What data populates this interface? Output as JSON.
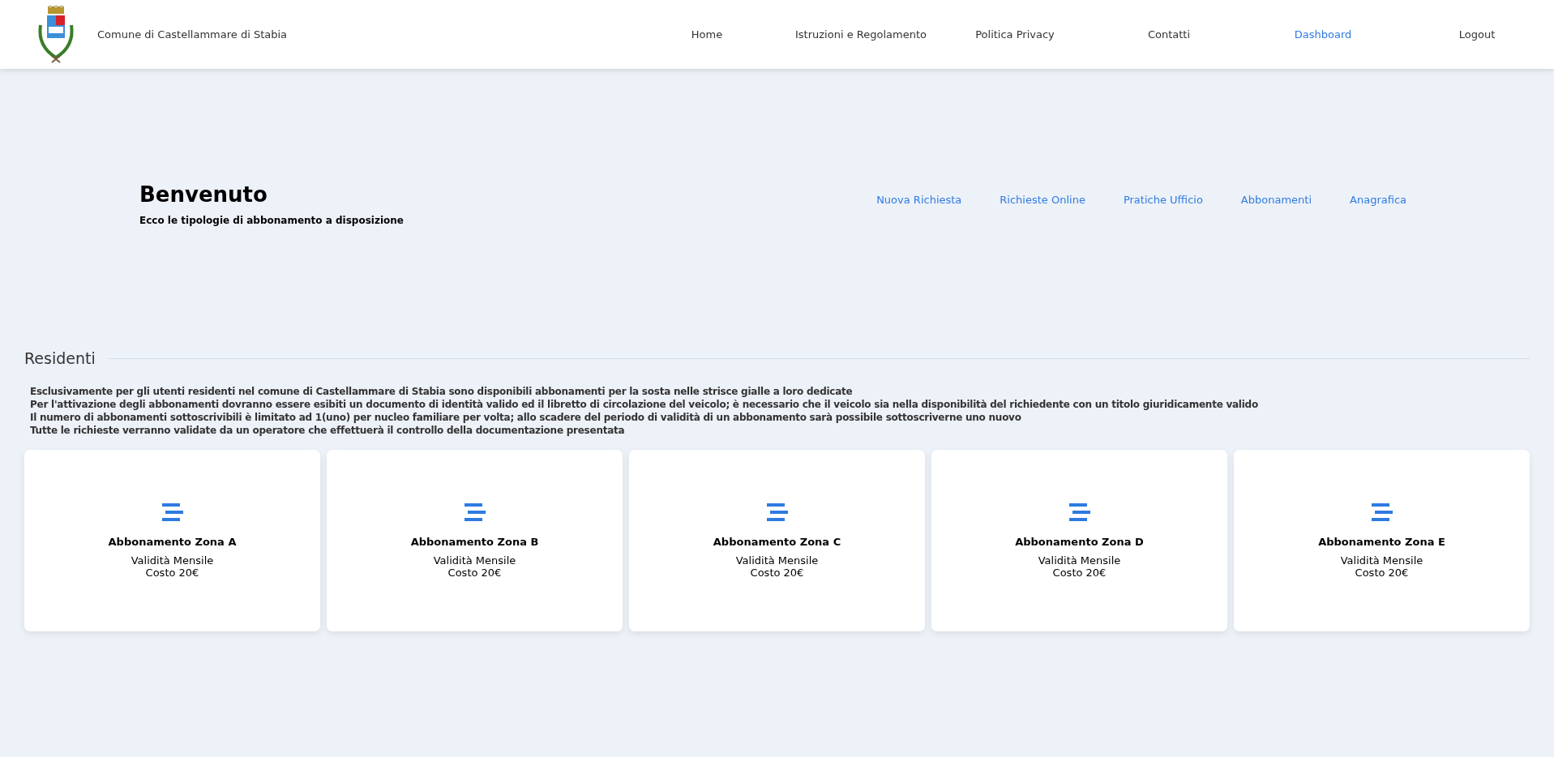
{
  "header": {
    "title": "Comune di Castellammare di Stabia",
    "nav": [
      {
        "label": "Home",
        "selected": false
      },
      {
        "label": "Istruzioni e Regolamento",
        "selected": false
      },
      {
        "label": "Politica Privacy",
        "selected": false
      },
      {
        "label": "Contatti",
        "selected": false
      },
      {
        "label": "Dashboard",
        "selected": true
      },
      {
        "label": "Logout",
        "selected": false
      }
    ]
  },
  "welcome": {
    "title": "Benvenuto",
    "subtitle": "Ecco le tipologie di abbonamento a disposizione",
    "links": [
      "Nuova Richiesta",
      "Richieste Online",
      "Pratiche Ufficio",
      "Abbonamenti",
      "Anagrafica"
    ]
  },
  "section": {
    "title": "Residenti",
    "notes": [
      "Esclusivamente per gli utenti residenti nel comune di Castellammare di Stabia sono disponibili abbonamenti per la sosta nelle strisce gialle a loro dedicate",
      "Per l'attivazione degli abbonamenti dovranno essere esibiti un documento di identità valido ed il libretto di circolazione del veicolo; è necessario che il veicolo sia nella disponibilità del richiedente con un titolo giuridicamente valido",
      "Il numero di abbonamenti sottoscrivibili è limitato ad 1(uno) per nucleo familiare per volta; allo scadere del periodo di validità di un abbonamento sarà possibile sottoscriverne uno nuovo",
      "Tutte le richieste verranno validate da un operatore che effettuerà il controllo della documentazione presentata"
    ],
    "cards": [
      {
        "title": "Abbonamento Zona A",
        "validity": "Validità Mensile",
        "cost": "Costo 20€"
      },
      {
        "title": "Abbonamento Zona B",
        "validity": "Validità Mensile",
        "cost": "Costo 20€"
      },
      {
        "title": "Abbonamento Zona C",
        "validity": "Validità Mensile",
        "cost": "Costo 20€"
      },
      {
        "title": "Abbonamento Zona D",
        "validity": "Validità Mensile",
        "cost": "Costo 20€"
      },
      {
        "title": "Abbonamento Zona E",
        "validity": "Validità Mensile",
        "cost": "Costo 20€"
      }
    ]
  }
}
